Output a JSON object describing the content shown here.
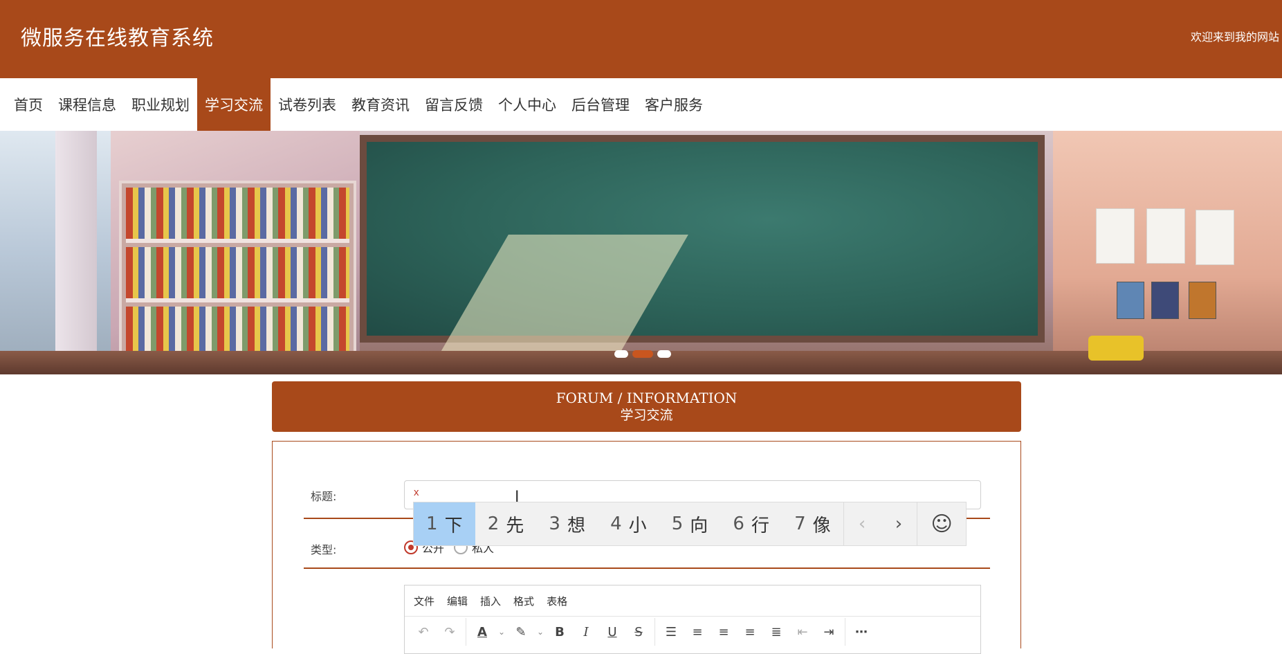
{
  "header": {
    "site_title": "微服务在线教育系统",
    "welcome": "欢迎来到我的网站"
  },
  "nav": {
    "items": [
      {
        "label": "首页",
        "active": false
      },
      {
        "label": "课程信息",
        "active": false
      },
      {
        "label": "职业规划",
        "active": false
      },
      {
        "label": "学习交流",
        "active": true
      },
      {
        "label": "试卷列表",
        "active": false
      },
      {
        "label": "教育资讯",
        "active": false
      },
      {
        "label": "留言反馈",
        "active": false
      },
      {
        "label": "个人中心",
        "active": false
      },
      {
        "label": "后台管理",
        "active": false
      },
      {
        "label": "客户服务",
        "active": false
      }
    ]
  },
  "banner": {
    "slides": 3,
    "active_slide": 1
  },
  "forum": {
    "title_en": "FORUM / INFORMATION",
    "title_cn": "学习交流"
  },
  "form": {
    "title_label": "标题:",
    "title_value": "x",
    "type_label": "类型:",
    "type_options": [
      "公开",
      "私人"
    ],
    "type_selected": "公开"
  },
  "editor": {
    "menus": [
      "文件",
      "编辑",
      "插入",
      "格式",
      "表格"
    ],
    "toolbar_icons": [
      "undo-icon",
      "redo-icon",
      "font-color-icon",
      "highlight-icon",
      "bold-icon",
      "italic-icon",
      "underline-icon",
      "strikethrough-icon",
      "line-height-icon",
      "align-left-icon",
      "align-center-icon",
      "align-right-icon",
      "align-justify-icon",
      "outdent-icon",
      "indent-icon",
      "more-icon"
    ]
  },
  "ime": {
    "candidates": [
      {
        "num": "1",
        "char": "下"
      },
      {
        "num": "2",
        "char": "先"
      },
      {
        "num": "3",
        "char": "想"
      },
      {
        "num": "4",
        "char": "小"
      },
      {
        "num": "5",
        "char": "向"
      },
      {
        "num": "6",
        "char": "行"
      },
      {
        "num": "7",
        "char": "像"
      }
    ],
    "selected_index": 0
  },
  "colors": {
    "brand": "#a8491a",
    "ime_selected": "#a8d0f5",
    "radio_checked": "#c0392b"
  }
}
